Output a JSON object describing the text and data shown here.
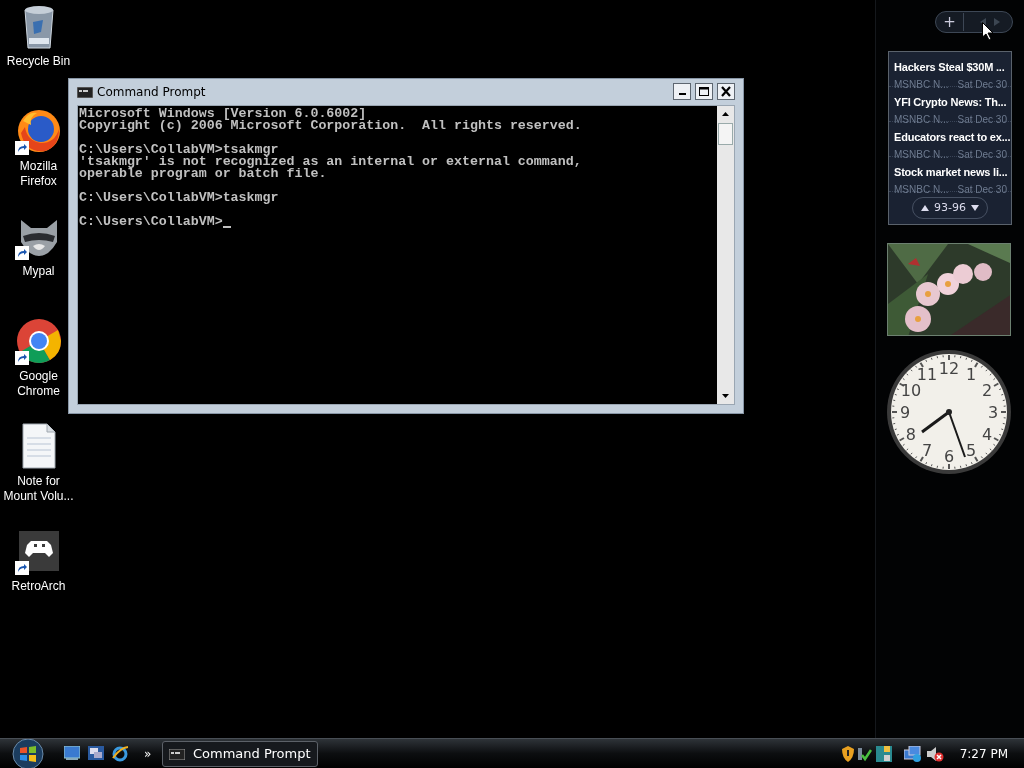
{
  "desktop_icons": [
    {
      "label": "Recycle Bin",
      "kind": "recycle",
      "shortcut": false
    },
    {
      "label": "Mozilla Firefox",
      "kind": "firefox",
      "shortcut": true
    },
    {
      "label": "Mypal",
      "kind": "raccoon",
      "shortcut": true
    },
    {
      "label": "Google Chrome",
      "kind": "chrome",
      "shortcut": true
    },
    {
      "label": "Note for Mount Volu...",
      "kind": "note",
      "shortcut": false
    },
    {
      "label": "RetroArch",
      "kind": "gamepad",
      "shortcut": true
    }
  ],
  "console_window": {
    "title": "Command Prompt",
    "blocks": [
      [
        "Microsoft Windows [Version 6.0.6002]",
        "Copyright (c) 2006 Microsoft Corporation.  All rights reserved."
      ],
      [
        "C:\\Users\\CollabVM>tsakmgr",
        "'tsakmgr' is not recognized as an internal or external command,",
        "operable program or batch file."
      ],
      [
        "C:\\Users\\CollabVM>taskmgr"
      ],
      [
        "C:\\Users\\CollabVM>"
      ]
    ],
    "cursor": true
  },
  "sidebar": {
    "add_button": "+",
    "news": {
      "items": [
        {
          "headline": "Hackers Steal $30M ...",
          "source": "MSNBC N...",
          "date": "Sat Dec 30"
        },
        {
          "headline": "YFI Crypto News: Th...",
          "source": "MSNBC N...",
          "date": "Sat Dec 30"
        },
        {
          "headline": "Educators react to ex...",
          "source": "MSNBC N...",
          "date": "Sat Dec 30"
        },
        {
          "headline": "Stock market news li...",
          "source": "MSNBC N...",
          "date": "Sat Dec 30"
        }
      ],
      "pager": "93-96"
    },
    "clock": {
      "numerals": [
        "11",
        "12",
        "1",
        "10",
        "2",
        "9",
        "3",
        "8",
        "4",
        "7",
        "5",
        "6"
      ]
    }
  },
  "taskbar": {
    "more": "»",
    "tasks": [
      {
        "label": "Command Prompt",
        "selected": false
      }
    ],
    "time": "7:27 PM"
  }
}
